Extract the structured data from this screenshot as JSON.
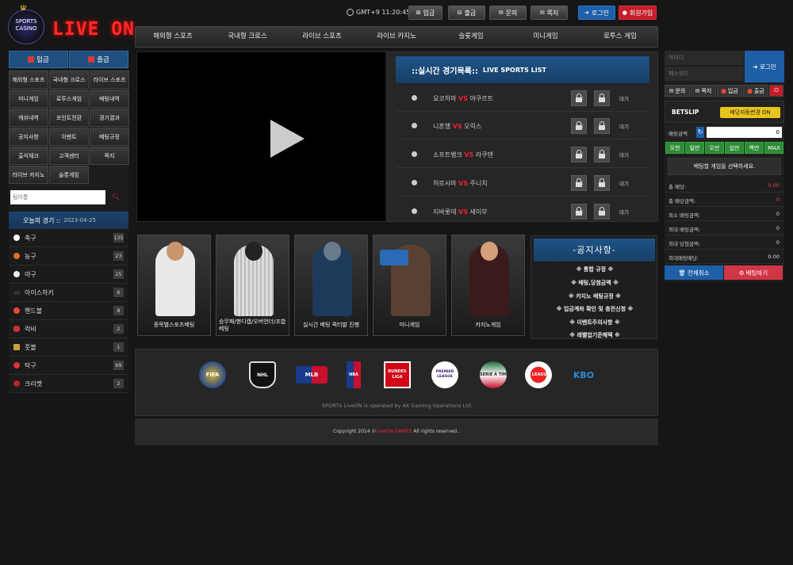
{
  "header": {
    "logo_badge_top": "SPORTS",
    "logo_badge_bottom": "CASINO",
    "logo_text": "LIVE ON",
    "clock": "GMT+9 11:20:45",
    "buttons": {
      "deposit": "입금",
      "withdraw": "출금",
      "inquiry": "문의",
      "message": "쪽지",
      "login": "로그인",
      "signup": "회원가입"
    }
  },
  "nav": [
    "해외형 스포츠",
    "국내형 크로스",
    "라이브 스포츠",
    "라이브 카지노",
    "슬롯게임",
    "미니게임",
    "로투스 게임"
  ],
  "left": {
    "deposit": "입금",
    "withdraw": "출금",
    "menu": [
      "해외형 스포츠",
      "국내형 크로스",
      "라이브 스포츠",
      "미니게임",
      "로투스게임",
      "배팅내역",
      "캐쉬내역",
      "포인트전환",
      "경기결과",
      "공지사항",
      "이벤트",
      "베팅규정",
      "출석체크",
      "고객센터",
      "쪽지",
      "라이브 카지노",
      "슬롯게임"
    ],
    "search_placeholder": "팀이름",
    "today_label": "오늘의 경기 ::",
    "today_date": "2023-04-25",
    "sports": [
      {
        "name": "축구",
        "count": "135"
      },
      {
        "name": "농구",
        "count": "23"
      },
      {
        "name": "야구",
        "count": "25"
      },
      {
        "name": "아이스하키",
        "count": "6"
      },
      {
        "name": "핸드볼",
        "count": "8"
      },
      {
        "name": "럭비",
        "count": "2"
      },
      {
        "name": "풋볼",
        "count": "1"
      },
      {
        "name": "탁구",
        "count": "69"
      },
      {
        "name": "크리켓",
        "count": "2"
      }
    ]
  },
  "live": {
    "title_ko": "::실시간 경기목록::",
    "title_en": "LIVE SPORTS LIST",
    "games": [
      {
        "home": "요코하마",
        "vs": "VS",
        "away": "야쿠르트",
        "colon": ":",
        "status": "대기"
      },
      {
        "home": "니혼햄",
        "vs": "VS",
        "away": "오릭스",
        "colon": ":",
        "status": "대기"
      },
      {
        "home": "소프트뱅크",
        "vs": "VS",
        "away": "라쿠텐",
        "colon": ":",
        "status": "대기"
      },
      {
        "home": "히로시마",
        "vs": "VS",
        "away": "주니치",
        "colon": ":",
        "status": "대기"
      },
      {
        "home": "지바롯데",
        "vs": "VS",
        "away": "세이부",
        "colon": ":",
        "status": "대기"
      }
    ]
  },
  "banners": [
    {
      "caption": "종목별스포츠베팅"
    },
    {
      "caption": "승무패/핸디캡/오버언더/조합베팅"
    },
    {
      "caption": "실시간 베팅 퀵터발 진행"
    },
    {
      "caption": "미니게임"
    },
    {
      "caption": "카지노게임"
    }
  ],
  "notice": {
    "title": "-공지사항-",
    "items": [
      "※ 통합 규정 ※",
      "※ 배팅,당첨금액 ※",
      "※ 카지노 배팅규정 ※",
      "※ 입금계좌 확인 및 충전신청 ※",
      "※ 이벤트주의사항 ※",
      "※ 레벨업기준혜택 ※"
    ]
  },
  "partners": [
    "FIFA",
    "NHL",
    "MLB",
    "NBA",
    "BUNDES LIGA",
    "PREMIER LEAGUE",
    "SERIE A TIM",
    "K LEAGUE",
    "KBO"
  ],
  "operated": "SPORTS LiveON is operated by AK Gaming Operations Ltd.",
  "footer": {
    "copyright": "Copyright 2014 ©",
    "brand": "LiveON GAMES",
    "rights": " All rights reserved.."
  },
  "right": {
    "id_placeholder": "아이디",
    "pw_placeholder": "패스워드",
    "login": "로그인",
    "tools": [
      "문의",
      "쪽지",
      "입금",
      "출금"
    ],
    "betslip": "BETSLIP",
    "auto_odds": "배당자동변경 ON",
    "amount_label": "배팅금액",
    "amount_value": "0",
    "chips": [
      "오천",
      "일만",
      "오만",
      "십만",
      "백만",
      "MAX"
    ],
    "select_msg": "베팅할 게임을 선택하세요.",
    "stats": [
      {
        "k": "총 배당:",
        "v": "0.00",
        "red": true
      },
      {
        "k": "총 배당금액:",
        "v": "0",
        "red": true
      },
      {
        "k": "최소 배팅금액:",
        "v": "0",
        "red": false
      },
      {
        "k": "최대 배팅금액:",
        "v": "0",
        "red": false
      },
      {
        "k": "최대 당첨금액:",
        "v": "0",
        "red": false
      },
      {
        "k": "최대배팅배당:",
        "v": "0.00",
        "red": false
      }
    ],
    "cancel_all": "전체취소",
    "bet_now": "배팅하기"
  },
  "colors": {
    "accent_blue": "#1e5fa8",
    "accent_red": "#c41e2a",
    "logo_red": "#ff2a2a",
    "chip_green": "#2e8b36",
    "toggle_yellow": "#e8c51c"
  }
}
